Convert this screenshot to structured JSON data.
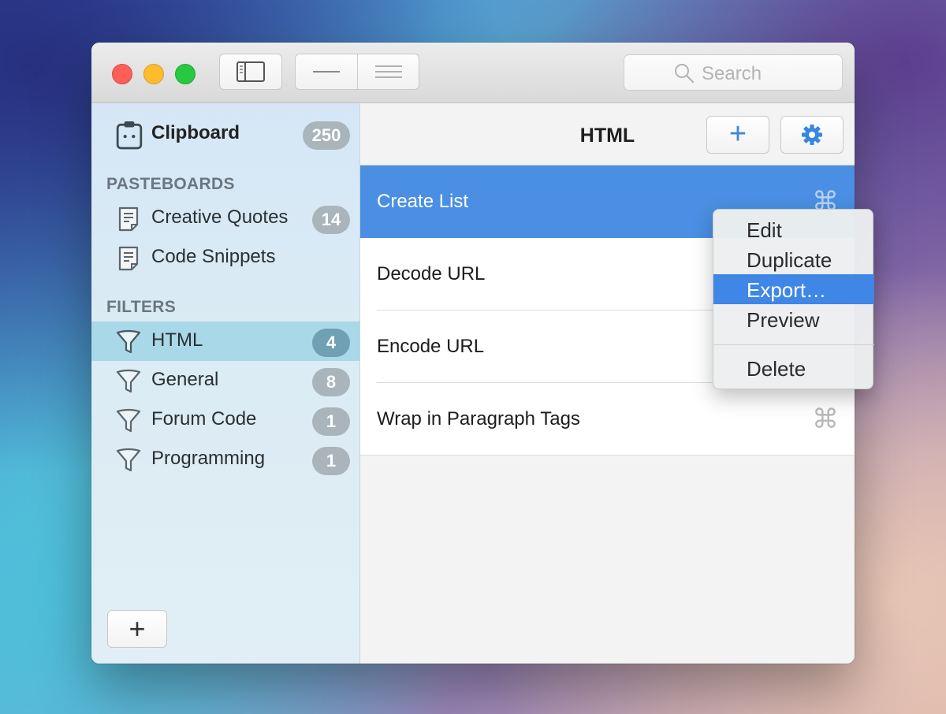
{
  "search": {
    "placeholder": "Search"
  },
  "sidebar": {
    "clipboard": {
      "label": "Clipboard",
      "count": "250"
    },
    "pasteboards_header": "PASTEBOARDS",
    "pasteboards": [
      {
        "label": "Creative Quotes",
        "count": "14"
      },
      {
        "label": "Code Snippets",
        "count": ""
      }
    ],
    "filters_header": "FILTERS",
    "filters": [
      {
        "label": "HTML",
        "count": "4",
        "selected": true
      },
      {
        "label": "General",
        "count": "8"
      },
      {
        "label": "Forum Code",
        "count": "1"
      },
      {
        "label": "Programming",
        "count": "1"
      }
    ],
    "add_label": "+"
  },
  "content": {
    "title": "HTML",
    "add_label": "+",
    "items": [
      {
        "label": "Create List",
        "shortcut": "⌘",
        "selected": true
      },
      {
        "label": "Decode URL",
        "shortcut": ""
      },
      {
        "label": "Encode URL",
        "shortcut": ""
      },
      {
        "label": "Wrap in Paragraph Tags",
        "shortcut": "⌘"
      }
    ]
  },
  "context_menu": {
    "items": [
      "Edit",
      "Duplicate",
      "Export…",
      "Preview",
      "Delete"
    ],
    "highlighted": "Export…"
  },
  "colors": {
    "accent": "#4a8fe3",
    "sidebar_selected": "#a9d8e8",
    "badge": "#a9b4bb",
    "badge_selected": "#6fa0b4"
  }
}
